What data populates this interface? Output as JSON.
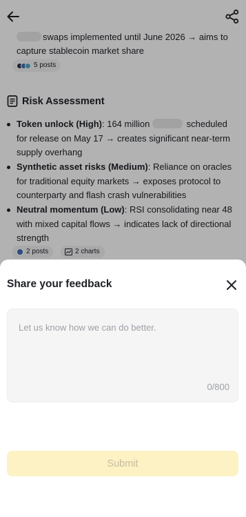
{
  "topbar": {
    "back_icon": "arrow-left-icon",
    "share_icon": "share-icon"
  },
  "article": {
    "intro_text": "swaps implemented until June 2026 → aims to capture stablecoin market share",
    "intro_posts": "5 posts",
    "risk_title": "Risk Assessment",
    "risk_icon": "document-icon",
    "bullets": [
      {
        "title": "Token unlock (High)",
        "text_a": ": 164 million",
        "text_b": "scheduled for release on May 17 → creates significant near-term supply overhang"
      },
      {
        "title": "Synthetic asset risks (Medium)",
        "text": ": Reliance on oracles for traditional equity markets → exposes protocol to counterparty and flash crash vulnerabilities"
      },
      {
        "title": "Neutral momentum (Low)",
        "text": ": RSI consolidating near 48 with mixed capital flows → indicates lack of directional strength"
      }
    ],
    "risk_posts": "2 posts",
    "risk_charts": "2 charts"
  },
  "feedback_sheet": {
    "title": "Share your feedback",
    "close_icon": "close-icon",
    "placeholder": "Let us know how we can do better.",
    "value": "",
    "counter": "0/800",
    "submit_label": "Submit",
    "submit_bg": "#fdf2c4",
    "submit_text_color": "#c4bca0"
  }
}
